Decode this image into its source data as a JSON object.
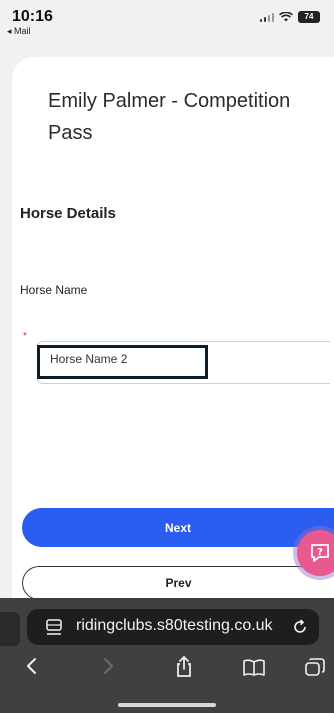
{
  "status_bar": {
    "time": "10:16",
    "back_app": "◂ Mail",
    "battery": "74"
  },
  "form": {
    "title": "Emily Palmer - Competition Pass",
    "section_title": "Horse Details",
    "field_label": "Horse Name",
    "required_mark": "*",
    "horse_name_value": "Horse Name 2"
  },
  "buttons": {
    "next": "Next",
    "prev": "Prev"
  },
  "browser": {
    "url": "ridingclubs.s80testing.co.uk"
  },
  "colors": {
    "primary": "#2b5ef0",
    "help_fab": "#e85a8f",
    "highlight_border": "#0c1e2c"
  },
  "icons": {
    "help": "help-chat-icon",
    "back": "chevron-left-icon",
    "forward": "chevron-right-icon",
    "share": "share-icon",
    "bookmarks": "book-icon",
    "tabs": "tabs-icon",
    "reload": "reload-icon",
    "page_settings": "page-settings-icon"
  }
}
